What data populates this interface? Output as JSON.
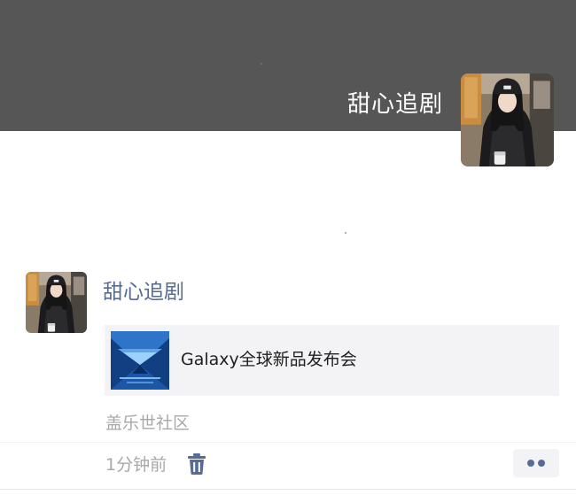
{
  "profile": {
    "name": "甜心追剧"
  },
  "post": {
    "author": "甜心追剧",
    "link": {
      "title": "Galaxy全球新品发布会"
    },
    "source": "盖乐世社区",
    "time": "1分钟前"
  },
  "icons": {
    "delete": "trash-icon",
    "more": "more-dots-icon"
  },
  "colors": {
    "cover_background": "#565656",
    "author_name": "#576b95",
    "secondary_text": "#a8a8a8",
    "card_background": "#f3f3f5"
  }
}
